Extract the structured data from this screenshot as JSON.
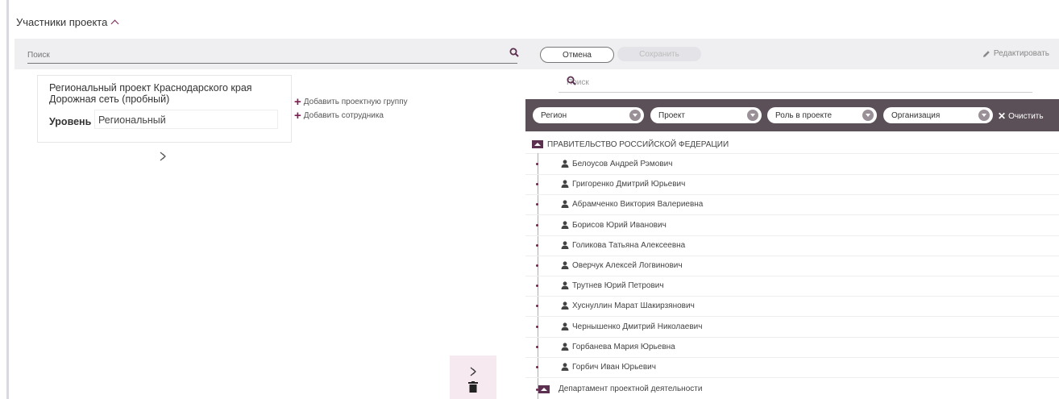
{
  "section": {
    "title": "Участники проекта"
  },
  "toolbar": {
    "search_placeholder": "Поиск",
    "cancel_label": "Отмена",
    "save_label": "Сохранить",
    "edit_label": "Редактировать"
  },
  "project_card": {
    "title": "Региональный проект Краснодарского края Дорожная сеть (пробный)",
    "level_label": "Уровень",
    "level_value": "Региональный"
  },
  "actions": {
    "add_group": "Добавить проектную группу",
    "add_employee": "Добавить сотрудника"
  },
  "right_panel": {
    "search_placeholder": "Поиск",
    "filters": [
      {
        "label": "Регион"
      },
      {
        "label": "Проект"
      },
      {
        "label": "Роль в проекте"
      },
      {
        "label": "Организация"
      }
    ],
    "clear_label": "Очистить",
    "organization": "ПРАВИТЕЛЬСТВО РОССИЙСКОЙ ФЕДЕРАЦИИ",
    "people": [
      "Белоусов Андрей Рэмович",
      "Григоренко Дмитрий Юрьевич",
      "Абрамченко Виктория Валериевна",
      "Борисов Юрий Иванович",
      "Голикова Татьяна Алексеевна",
      "Оверчук Алексей Логвинович",
      "Трутнев Юрий Петрович",
      "Хуснуллин Марат Шакирзянович",
      "Чернышенко Дмитрий Николаевич",
      "Горбанева Мария Юрьевна",
      "Горбич Иван Юрьевич"
    ],
    "department": "Департамент проектной деятельности"
  },
  "colors": {
    "accent": "#7a2050",
    "filter_bar": "#5c5058",
    "toolbar_bg": "#efeff1"
  }
}
